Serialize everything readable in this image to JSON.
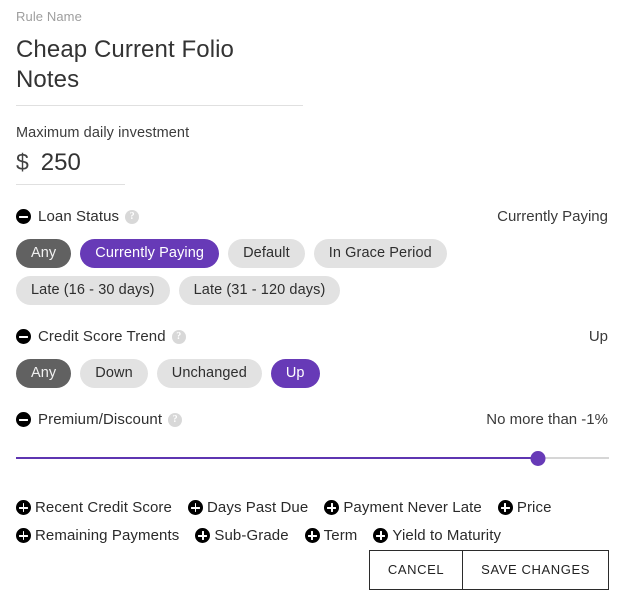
{
  "rule_name": {
    "label": "Rule Name",
    "value": "Cheap Current Folio Notes"
  },
  "max_investment": {
    "label": "Maximum daily investment",
    "currency": "$",
    "value": "250"
  },
  "icons": {
    "collapse": "minus-circle-icon",
    "expand": "plus-circle-icon",
    "help": "?"
  },
  "filters": [
    {
      "name": "loan-status",
      "title": "Loan Status",
      "value": "Currently Paying",
      "options": [
        {
          "label": "Any",
          "state": "any"
        },
        {
          "label": "Currently Paying",
          "state": "selected"
        },
        {
          "label": "Default",
          "state": "off"
        },
        {
          "label": "In Grace Period",
          "state": "off"
        },
        {
          "label": "Late (16 - 30 days)",
          "state": "off"
        },
        {
          "label": "Late (31 - 120 days)",
          "state": "off"
        }
      ]
    },
    {
      "name": "credit-score-trend",
      "title": "Credit Score Trend",
      "value": "Up",
      "options": [
        {
          "label": "Any",
          "state": "any"
        },
        {
          "label": "Down",
          "state": "off"
        },
        {
          "label": "Unchanged",
          "state": "off"
        },
        {
          "label": "Up",
          "state": "selected"
        }
      ]
    }
  ],
  "premium_discount": {
    "title": "Premium/Discount",
    "value": "No more than -1%",
    "slider": {
      "percent": 88,
      "track_color": "#d6d6d6",
      "fill_color": "#5e35b1",
      "thumb_color": "#673ab7"
    }
  },
  "available_filters": {
    "row1": [
      "Recent Credit Score",
      "Days Past Due",
      "Payment Never Late",
      "Price"
    ],
    "row2": [
      "Remaining Payments",
      "Sub-Grade",
      "Term",
      "Yield to Maturity"
    ]
  },
  "actions": {
    "cancel": "CANCEL",
    "save": "SAVE CHANGES"
  },
  "colors": {
    "accent_purple": "#673ab7",
    "chip_any": "#616161",
    "chip_off": "#e2e2e2"
  }
}
